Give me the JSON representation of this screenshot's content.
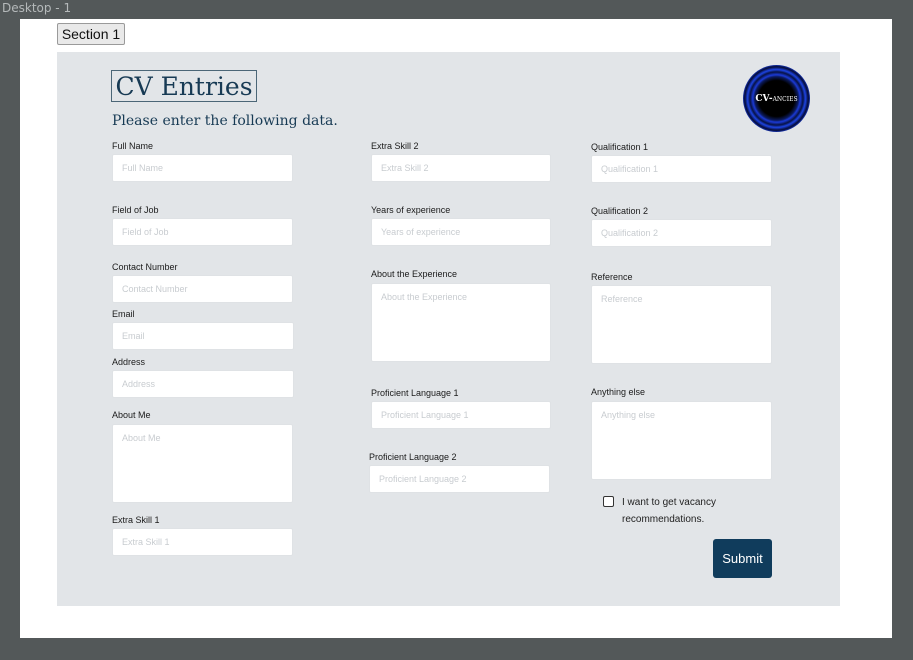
{
  "frame": {
    "label": "Desktop - 1"
  },
  "section_label": "Section 1",
  "form": {
    "title": "CV Entries",
    "subtitle": "Please enter the following data.",
    "logo": {
      "text_main": "CV-",
      "text_small": "ANCIES"
    },
    "fields": {
      "full_name": {
        "label": "Full Name",
        "placeholder": "Full Name"
      },
      "field_of_job": {
        "label": "Field of Job",
        "placeholder": "Field of Job"
      },
      "contact_number": {
        "label": "Contact Number",
        "placeholder": "Contact Number"
      },
      "email": {
        "label": "Email",
        "placeholder": "Email"
      },
      "address": {
        "label": "Address",
        "placeholder": "Address"
      },
      "about_me": {
        "label": "About Me",
        "placeholder": "About Me"
      },
      "extra_skill_1": {
        "label": "Extra Skill 1",
        "placeholder": "Extra Skill 1"
      },
      "extra_skill_2": {
        "label": "Extra Skill 2",
        "placeholder": "Extra Skill 2"
      },
      "years_of_experience": {
        "label": "Years of experience",
        "placeholder": "Years of experience"
      },
      "about_experience": {
        "label": "About the Experience",
        "placeholder": "About the Experience"
      },
      "proficient_language_1": {
        "label": "Proficient Language 1",
        "placeholder": "Proficient Language 1"
      },
      "proficient_language_2": {
        "label": "Proficient Language 2",
        "placeholder": "Proficient Language 2"
      },
      "qualification_1": {
        "label": "Qualification 1",
        "placeholder": "Qualification 1"
      },
      "qualification_2": {
        "label": "Qualification 2",
        "placeholder": "Qualification 2"
      },
      "reference": {
        "label": "Reference",
        "placeholder": "Reference"
      },
      "anything_else": {
        "label": "Anything else",
        "placeholder": "Anything else"
      }
    },
    "vacancy_checkbox": {
      "label": "I want to get vacancy recommendations.",
      "checked": false
    },
    "submit_label": "Submit"
  },
  "colors": {
    "outer_background": "#535859",
    "card_background": "#e2e5e8",
    "title_text": "#173a54",
    "submit_background": "#103c5c"
  }
}
